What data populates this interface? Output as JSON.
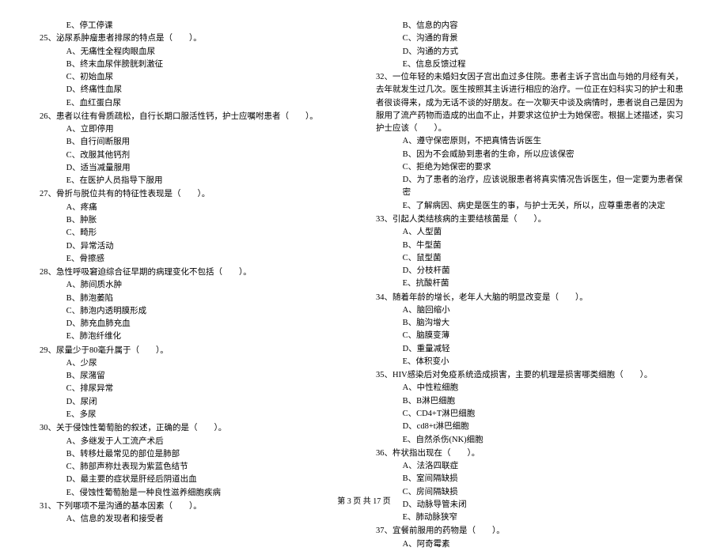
{
  "leftColumn": {
    "leadingOption": "E、停工停课",
    "questions": [
      {
        "num": "25",
        "text": "泌尿系肿瘤患者排尿的特点是（　　）。",
        "options": [
          "A、无痛性全程肉眼血尿",
          "B、终末血尿伴膀胱刺激征",
          "C、初始血尿",
          "D、终痛性血尿",
          "E、血红蛋白尿"
        ]
      },
      {
        "num": "26",
        "text": "患者以往有骨质疏松，自行长期口服活性钙，护士应嘱咐患者（　　）。",
        "options": [
          "A、立即停用",
          "B、自行间断服用",
          "C、改服其他钙剂",
          "D、适当减量服用",
          "E、在医护人员指导下服用"
        ]
      },
      {
        "num": "27",
        "text": "骨折与脱位共有的特征性表现是（　　）。",
        "options": [
          "A、疼痛",
          "B、肿胀",
          "C、畸形",
          "D、异常活动",
          "E、骨擦感"
        ]
      },
      {
        "num": "28",
        "text": "急性呼吸窘迫综合征早期的病理变化不包括（　　）。",
        "options": [
          "A、肺间质水肿",
          "B、肺泡萎陷",
          "C、肺泡内透明膜形成",
          "D、肺充血肺充血",
          "E、肺泡纤维化"
        ]
      },
      {
        "num": "29",
        "text": "尿量少于80毫升属于（　　）。",
        "options": [
          "A、少尿",
          "B、尿潴留",
          "C、排尿异常",
          "D、尿闭",
          "E、多尿"
        ]
      },
      {
        "num": "30",
        "text": "关于侵蚀性葡萄胎的叙述，正确的是（　　）。",
        "options": [
          "A、多继发于人工流产术后",
          "B、转移灶最常见的部位是肺部",
          "C、肺部声称灶表现为紫蓝色结节",
          "D、最主要的症状是肝经后阴道出血",
          "E、侵蚀性葡萄胎是一种良性滋养细胞疾病"
        ]
      },
      {
        "num": "31",
        "text": "下列哪项不是沟通的基本因素（　　）。",
        "options": [
          "A、信息的发现者和接受者"
        ]
      }
    ]
  },
  "rightColumn": {
    "leadingOptions": [
      "B、信息的内容",
      "C、沟通的背景",
      "D、沟通的方式",
      "E、信息反馈过程"
    ],
    "q32": {
      "num": "32",
      "para": "一位年轻的未婚妇女因子宫出血过多住院。患者主诉子宫出血与她的月经有关，去年就发生过几次。医生按照其主诉进行相应的治疗。一位正在妇科实习的护士和患者很谈得来，成为无话不谈的好朋友。在一次聊天中谈及病情时，患者说自己是因为服用了流产药物而造成的出血不止，并要求这位护士为她保密。根据上述描述，实习护士应该（　　）。",
      "options": [
        "A、遵守保密原则，不把真情告诉医生",
        "B、因为不会威胁到患者的生命，所以应该保密",
        "C、拒绝为她保密的要求",
        "D、为了患者的治疗，应该说服患者将真实情况告诉医生，但一定要为患者保密",
        "E、了解病因、病史是医生的事，与护士无关，所以，应尊重患者的决定"
      ]
    },
    "questions": [
      {
        "num": "33",
        "text": "引起人类结核病的主要结核菌是（　　）。",
        "options": [
          "A、人型菌",
          "B、牛型菌",
          "C、鼠型菌",
          "D、分枝杆菌",
          "E、抗酸杆菌"
        ]
      },
      {
        "num": "34",
        "text": "随着年龄的增长，老年人大脑的明显改变是（　　）。",
        "options": [
          "A、脑回缩小",
          "B、脑沟增大",
          "C、脑膜变薄",
          "D、重量减轻",
          "E、体积变小"
        ]
      },
      {
        "num": "35",
        "text": "HIV感染后对免疫系统造成损害，主要的机理是损害哪类细胞（　　）。",
        "options": [
          "A、中性粒细胞",
          "B、B淋巴细胞",
          "C、CD4+T淋巴细胞",
          "D、cd8+t淋巴细胞",
          "E、自然杀伤(NK)细胞"
        ]
      },
      {
        "num": "36",
        "text": "杵状指出现在（　　）。",
        "options": [
          "A、法洛四联症",
          "B、室间隔缺损",
          "C、房间隔缺损",
          "D、动脉导管未闭",
          "E、肺动脉狭窄"
        ]
      },
      {
        "num": "37",
        "text": "宜餐前服用的药物是（　　）。",
        "options": [
          "A、阿奇霉素"
        ]
      }
    ]
  },
  "footer": "第 3 页 共 17 页"
}
